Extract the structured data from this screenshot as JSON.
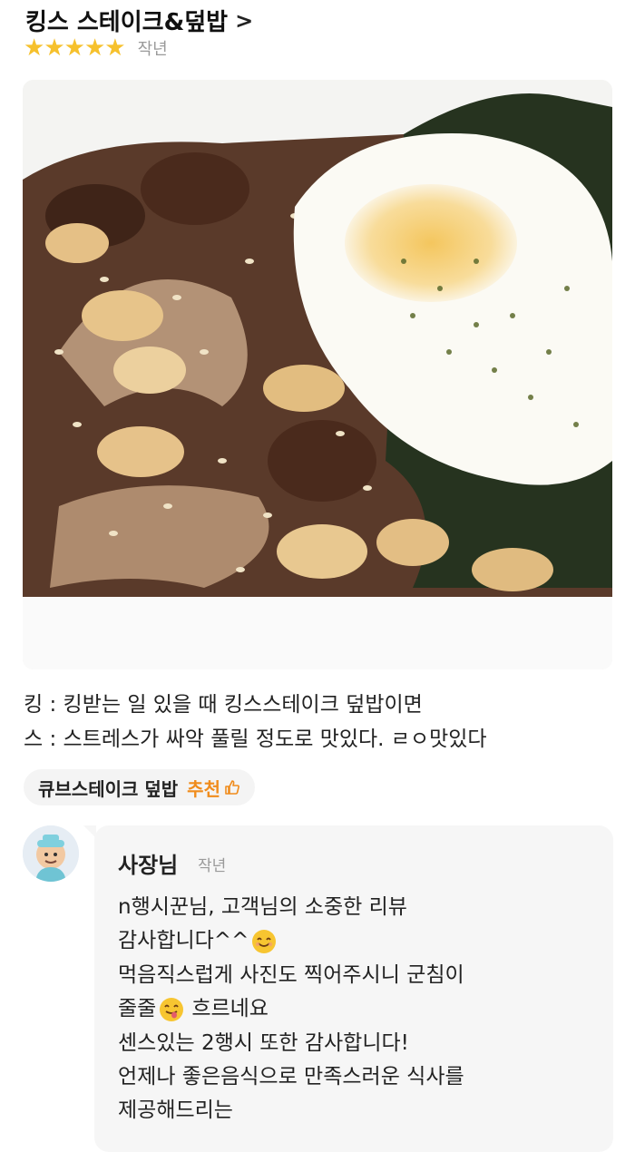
{
  "store": {
    "name": "킹스 스테이크&덮밥",
    "chevron": ">"
  },
  "rating": {
    "stars": 5,
    "star_char": "★",
    "time": "작년"
  },
  "review": {
    "lines": [
      "킹 : 킹받는 일 있을 때 킹스스테이크 덮밥이면",
      "스 : 스트레스가 싸악 풀릴 정도로 맛있다. ㄹㅇ맛있다"
    ]
  },
  "menu_tag": {
    "name": "큐브스테이크 덮밥",
    "recommend": "추천",
    "icon": "thumbs-up-icon"
  },
  "owner_reply": {
    "name": "사장님",
    "time": "작년",
    "lines": [
      "n행시꾼님, 고객님의 소중한 리뷰",
      "감사합니다^^",
      "먹음직스럽게 사진도 찍어주시니 군침이",
      "줄줄",
      "흐르네요",
      "센스있는 2행시 또한 감사합니다!",
      "언제나 좋은음식으로 만족스러운 식사를",
      "제공해드리는"
    ]
  },
  "colors": {
    "star": "#f6c12d",
    "recommend": "#f08c1c",
    "bubble": "#f6f6f6"
  }
}
